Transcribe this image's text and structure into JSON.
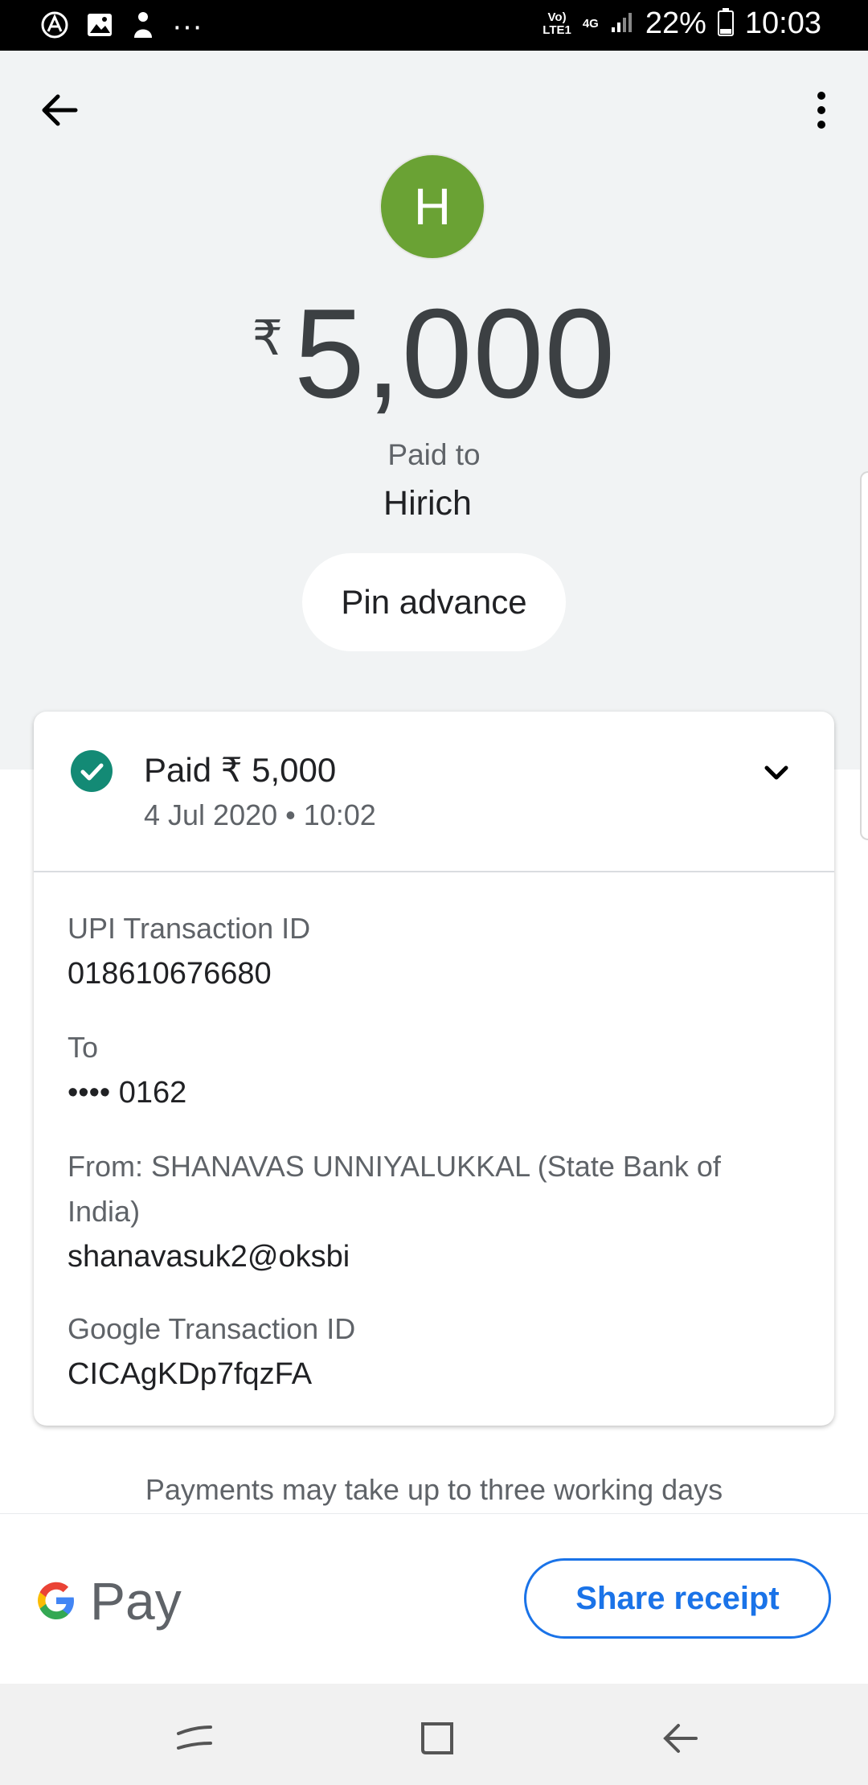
{
  "status_bar": {
    "network_top": "Vo)",
    "network_bottom": "LTE1",
    "data_type": "4G",
    "battery": "22%",
    "time": "10:03",
    "overflow": "···"
  },
  "payee": {
    "initial": "H",
    "avatar_color": "#6aa234",
    "currency_symbol": "₹",
    "amount": "5,000",
    "paid_to_label": "Paid to",
    "name": "Hirich",
    "note": "Pin advance"
  },
  "card": {
    "status": "Paid ₹ 5,000",
    "datetime": "4 Jul 2020 • 10:02",
    "status_color": "#138a75",
    "upi_label": "UPI Transaction ID",
    "upi_value": "018610676680",
    "to_label": "To",
    "to_value": "•••• 0162",
    "from_label": "From: SHANAVAS  UNNIYALUKKAL (State Bank of India)",
    "from_value": "shanavasuk2@oksbi",
    "google_label": "Google Transaction ID",
    "google_value": "CICAgKDp7fqzFA"
  },
  "notice": "Payments may take up to three working days",
  "footer": {
    "brand_text": "Pay",
    "share_label": "Share receipt",
    "accent": "#1a73e8"
  }
}
